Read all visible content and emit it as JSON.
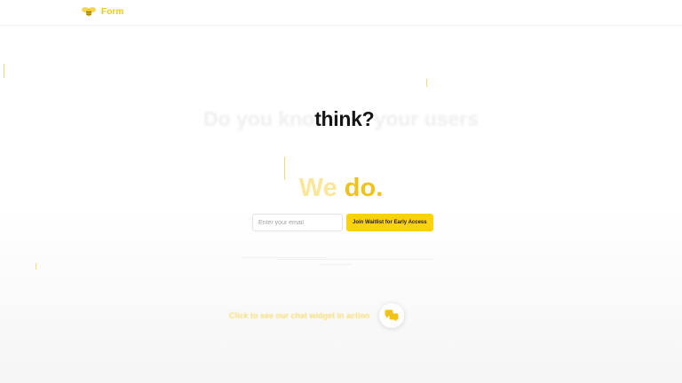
{
  "brand": {
    "name": "Form",
    "icon": "bee-icon",
    "color": "#f1c81a"
  },
  "hero": {
    "faded_prefix": "Do you kno",
    "strong_word": "think?",
    "faded_suffix": "your users",
    "subheading_we": "We",
    "subheading_do": "do."
  },
  "waitlist": {
    "email_placeholder": "Enter your email",
    "email_value": "",
    "join_label": "Join Waitlist for Early Access",
    "accent": "#fcd20f"
  },
  "cta": {
    "text": "Click to see our chat widget in action",
    "icon": "chat-bubbles-icon"
  }
}
